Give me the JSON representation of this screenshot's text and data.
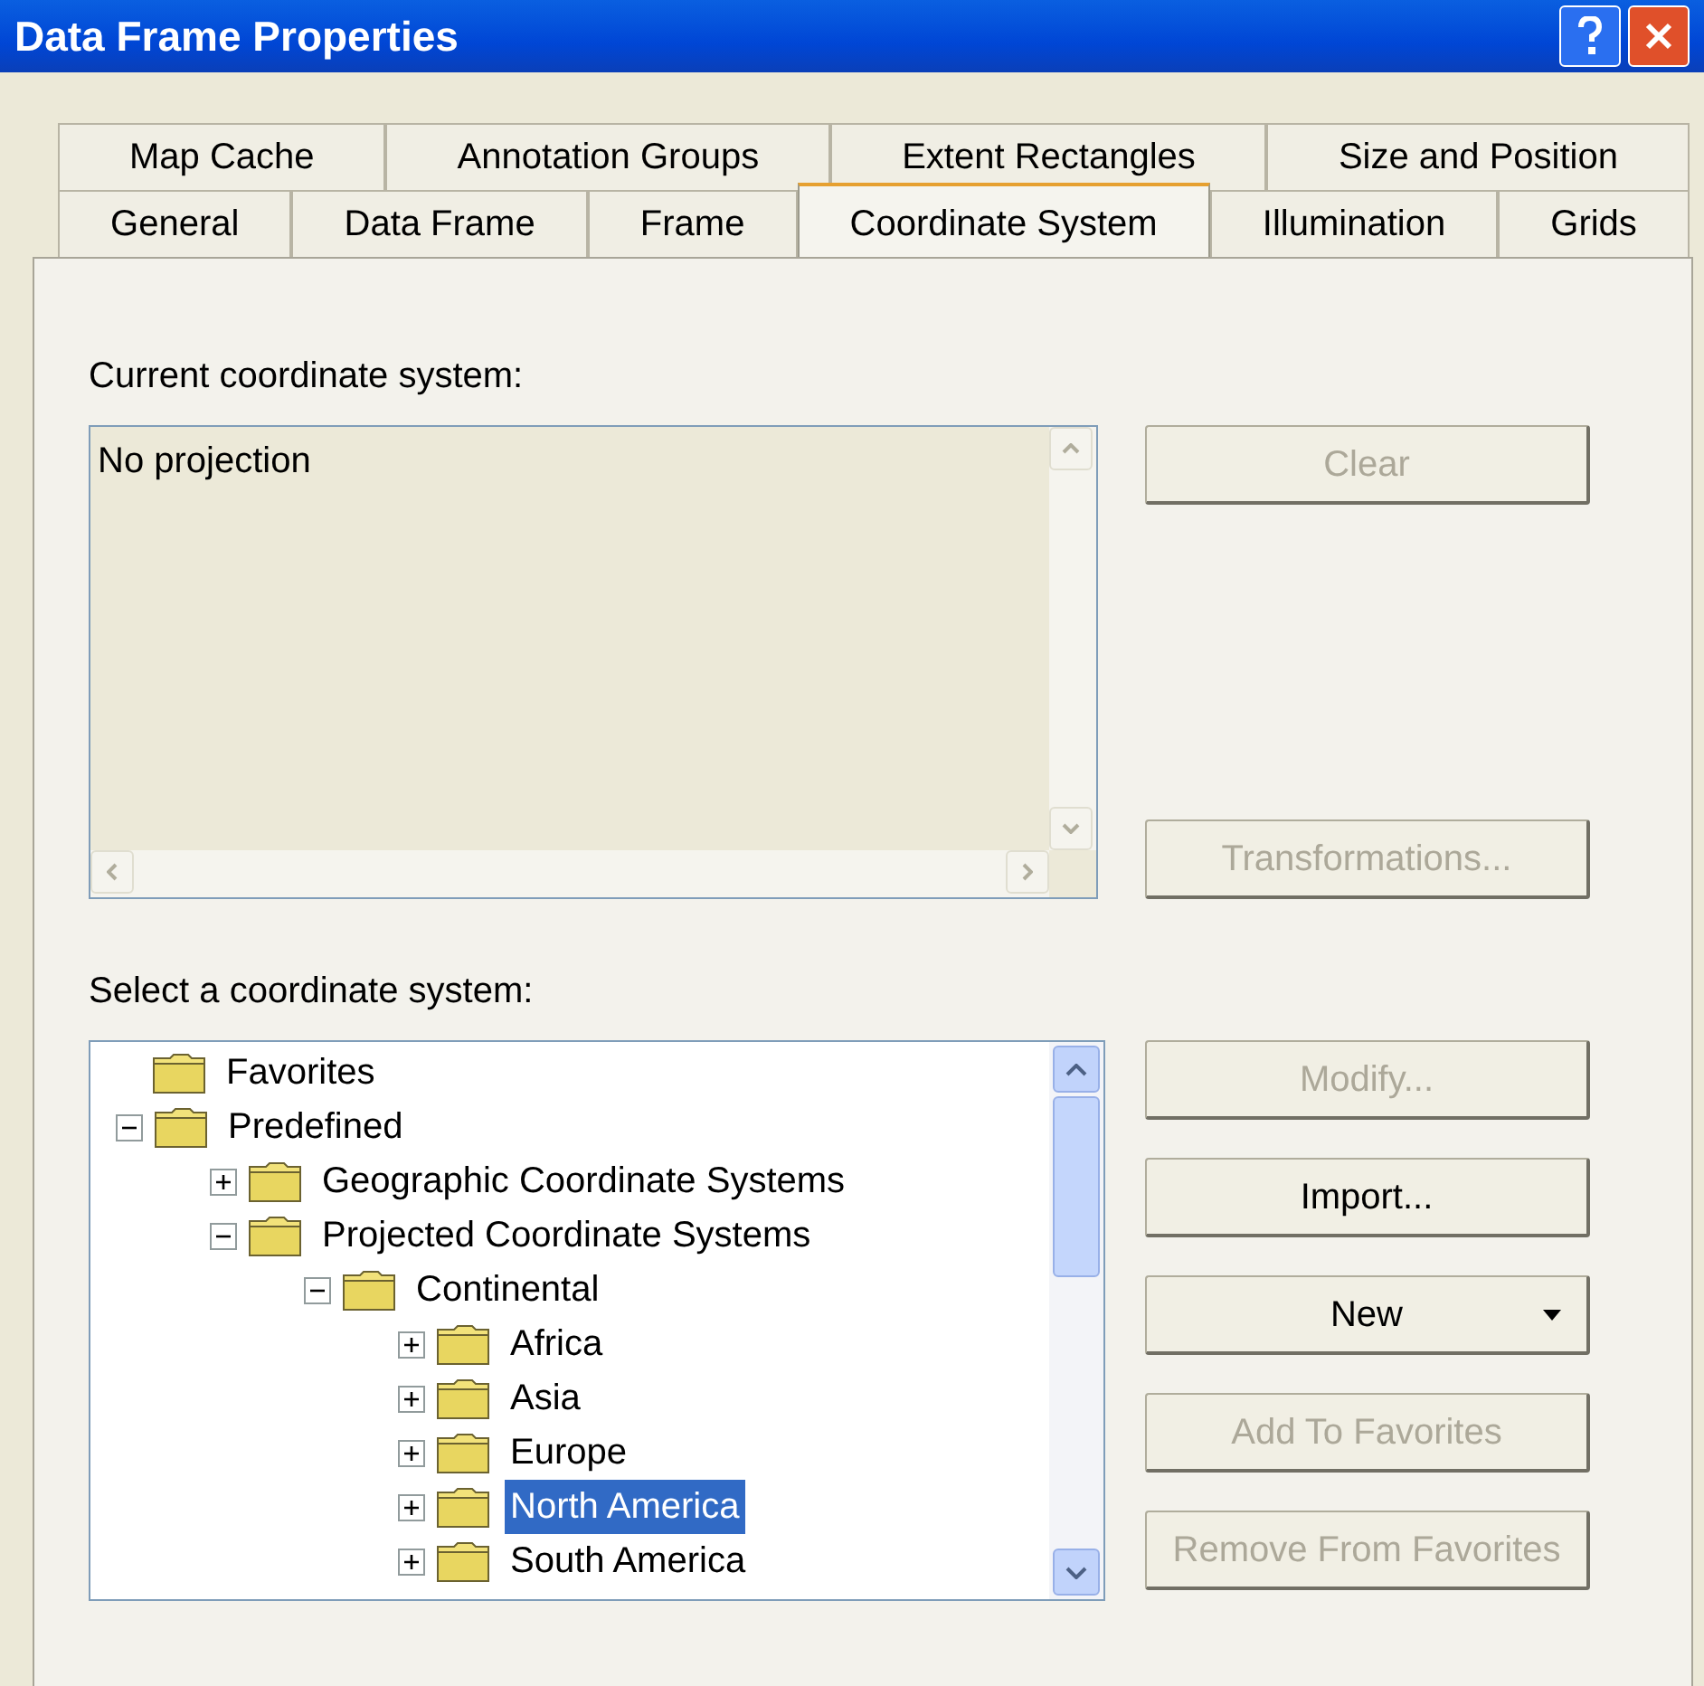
{
  "window": {
    "title": "Data Frame Properties"
  },
  "tab_rows": [
    [
      {
        "label": "Map Cache",
        "selected": false
      },
      {
        "label": "Annotation Groups",
        "selected": false
      },
      {
        "label": "Extent Rectangles",
        "selected": false
      },
      {
        "label": "Size and Position",
        "selected": false
      }
    ],
    [
      {
        "label": "General",
        "selected": false
      },
      {
        "label": "Data Frame",
        "selected": false
      },
      {
        "label": "Frame",
        "selected": false
      },
      {
        "label": "Coordinate System",
        "selected": true
      },
      {
        "label": "Illumination",
        "selected": false
      },
      {
        "label": "Grids",
        "selected": false
      }
    ]
  ],
  "current_label": "Current coordinate system:",
  "current_value": "No projection",
  "select_label": "Select a coordinate system:",
  "tree": [
    {
      "label": "Favorites",
      "selected": false
    },
    {
      "label": "Predefined",
      "selected": false,
      "expanded": true,
      "children": [
        {
          "label": "Geographic Coordinate Systems",
          "selected": false,
          "expanded": false
        },
        {
          "label": "Projected Coordinate Systems",
          "selected": false,
          "expanded": true,
          "children": [
            {
              "label": "Continental",
              "selected": false,
              "expanded": true,
              "children": [
                {
                  "label": "Africa",
                  "selected": false,
                  "expanded": false
                },
                {
                  "label": "Asia",
                  "selected": false,
                  "expanded": false
                },
                {
                  "label": "Europe",
                  "selected": false,
                  "expanded": false
                },
                {
                  "label": "North America",
                  "selected": true,
                  "expanded": false
                },
                {
                  "label": "South America",
                  "selected": false,
                  "expanded": false
                }
              ]
            }
          ]
        }
      ]
    }
  ],
  "top_buttons": [
    {
      "label": "Clear",
      "disabled": true
    },
    {
      "label": "Transformations...",
      "disabled": true
    }
  ],
  "side_buttons": [
    {
      "label": "Modify...",
      "disabled": true,
      "kind": "plain"
    },
    {
      "label": "Import...",
      "disabled": false,
      "kind": "plain"
    },
    {
      "label": "New",
      "disabled": false,
      "kind": "dropdown"
    },
    {
      "label": "Add To Favorites",
      "disabled": true,
      "kind": "plain"
    },
    {
      "label": "Remove From Favorites",
      "disabled": true,
      "kind": "plain"
    }
  ]
}
